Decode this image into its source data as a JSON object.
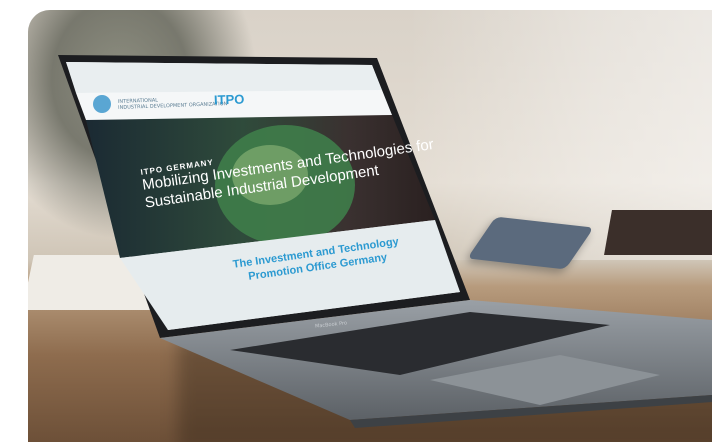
{
  "site": {
    "org_name_line1": "INTERNATIONAL",
    "org_name_line2": "INDUSTRIAL DEVELOPMENT ORGANIZATION",
    "logo_text": "ITPO",
    "hero_kicker": "ITPO GERMANY",
    "hero_title_line1": "Mobilizing Investments and Technologies for",
    "hero_title_line2": "Sustainable Industrial Development",
    "section_title_line1": "The Investment and Technology",
    "section_title_line2": "Promotion Office Germany"
  },
  "device": {
    "label": "MacBook Pro"
  },
  "colors": {
    "accent": "#2c9ad1",
    "header_bg": "#e9eef0",
    "section_bg": "#e6ecee"
  }
}
